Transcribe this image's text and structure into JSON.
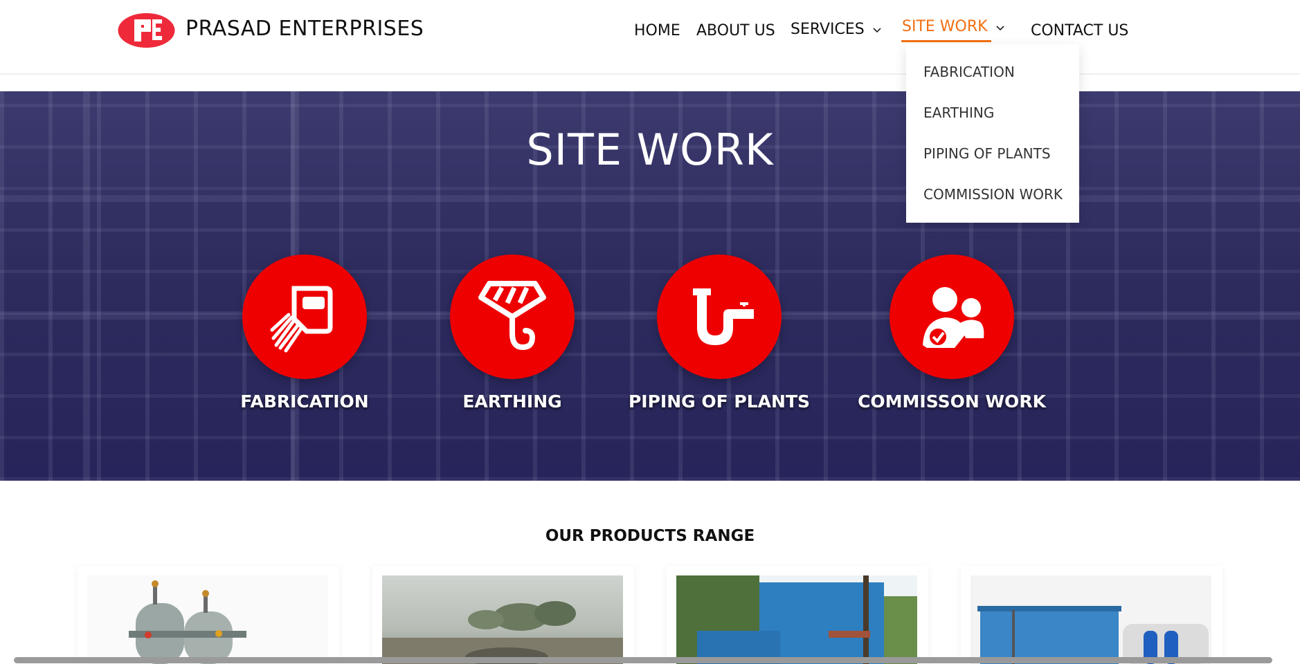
{
  "brand": {
    "name": "PRASAD ENTERPRISES",
    "logo_icon": "pe-logo-icon"
  },
  "nav": {
    "home": "HOME",
    "about": "ABOUT US",
    "services": "SERVICES",
    "site_work": "SITE WORK",
    "contact": "CONTACT US",
    "active": "SITE WORK",
    "active_color": "#f36f12"
  },
  "dropdown": {
    "items": [
      "FABRICATION",
      "EARTHING",
      "PIPING OF PLANTS",
      "COMMISSION WORK"
    ]
  },
  "hero": {
    "title": "SITE WORK",
    "cards": [
      {
        "label": "FABRICATION",
        "icon": "welding-shield-icon"
      },
      {
        "label": "EARTHING",
        "icon": "crane-hook-icon"
      },
      {
        "label": "PIPING OF PLANTS",
        "icon": "pipe-faucet-icon"
      },
      {
        "label": "COMMISSON WORK",
        "icon": "users-check-icon"
      }
    ],
    "accent_color": "#ee0000"
  },
  "products": {
    "title": "OUR PRODUCTS RANGE"
  }
}
